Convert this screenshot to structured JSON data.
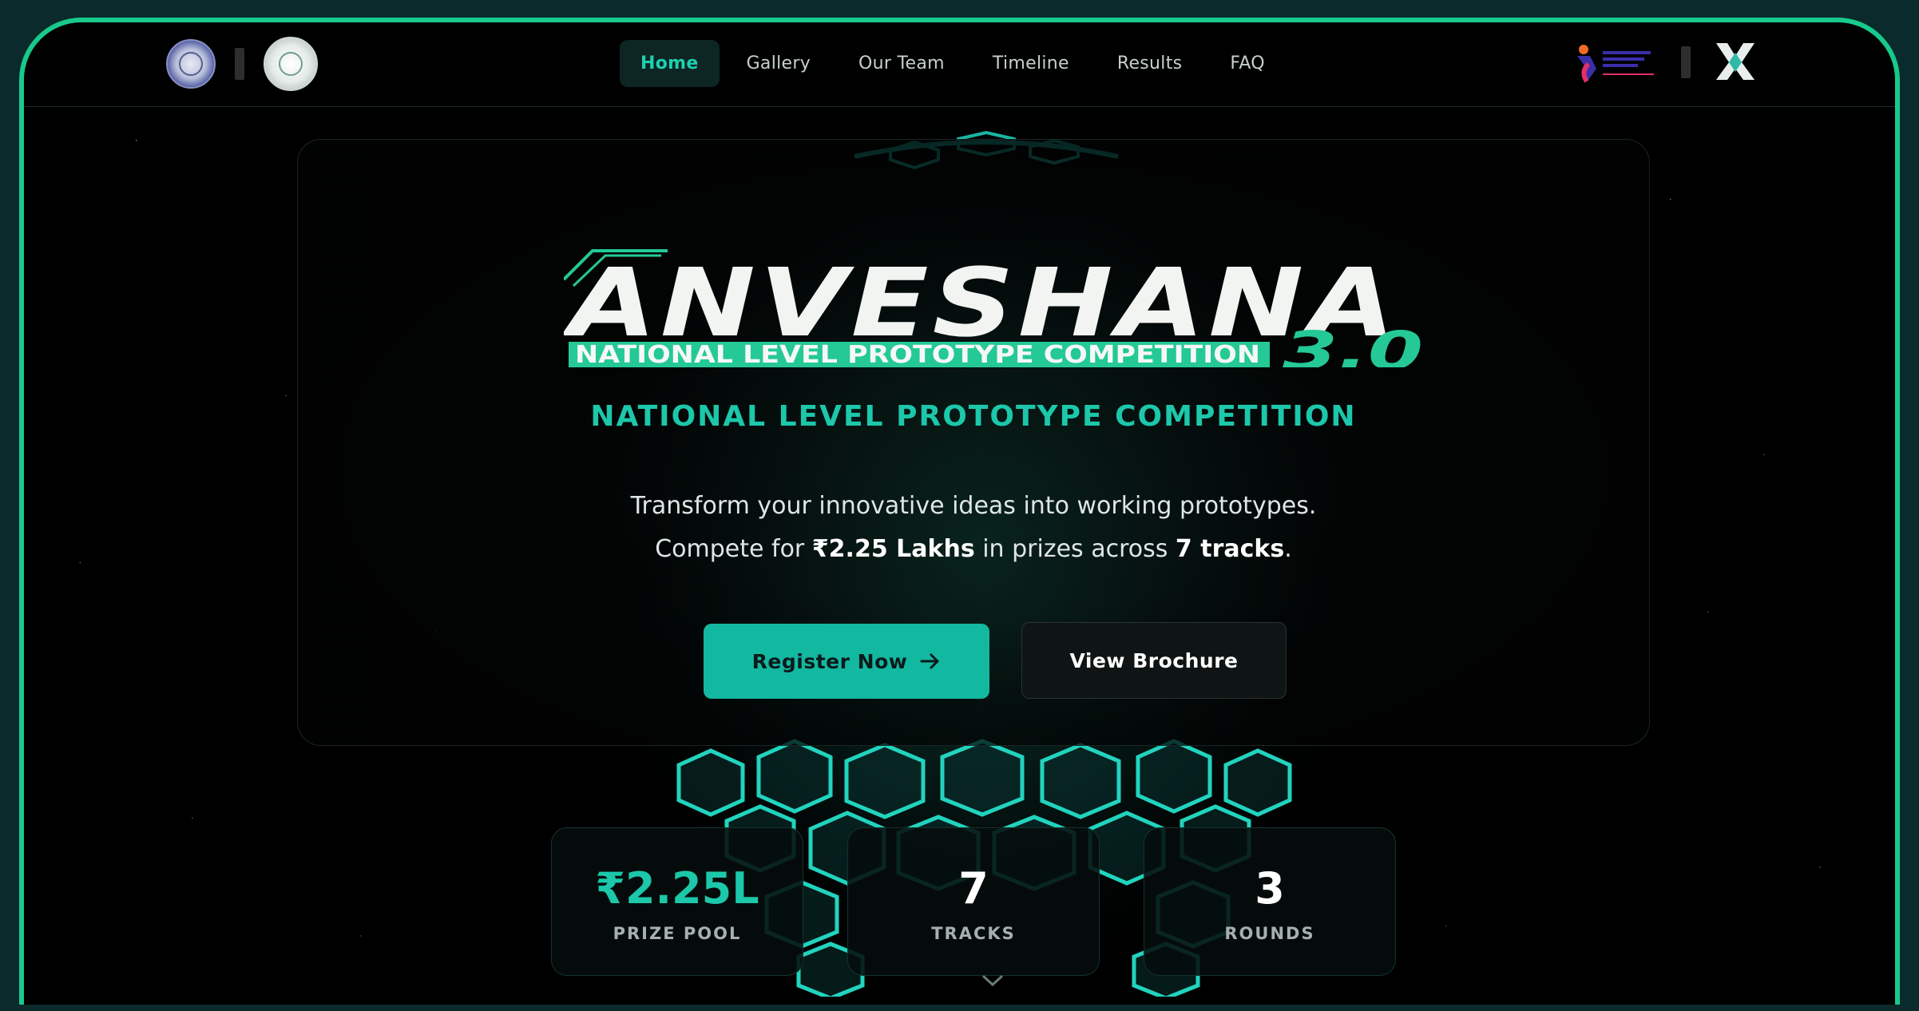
{
  "colors": {
    "accent": "#1cc7aa",
    "frame": "#18c98c",
    "background": "#000000",
    "button_primary": "#13b8a1"
  },
  "nav": {
    "left_logos": [
      "institute-seal-icon",
      "department-seal-icon"
    ],
    "right_logos": [
      "innovation-council-logo",
      "anveshana-logo"
    ],
    "items": [
      {
        "label": "Home",
        "active": true
      },
      {
        "label": "Gallery",
        "active": false
      },
      {
        "label": "Our Team",
        "active": false
      },
      {
        "label": "Timeline",
        "active": false
      },
      {
        "label": "Results",
        "active": false
      },
      {
        "label": "FAQ",
        "active": false
      }
    ]
  },
  "hero": {
    "logo_title": "ANVESHANA",
    "logo_subtitle": "NATIONAL LEVEL PROTOTYPE  COMPETITION",
    "logo_version": "3.0",
    "tagline": "NATIONAL LEVEL PROTOTYPE COMPETITION",
    "description_line1": "Transform your innovative ideas into working prototypes.",
    "description_line2_prefix": "Compete for ",
    "description_prize": "₹2.25 Lakhs",
    "description_line2_middle": " in prizes across ",
    "description_tracks": "7 tracks",
    "description_line2_suffix": ".",
    "register_label": "Register Now",
    "brochure_label": "View Brochure"
  },
  "stats": [
    {
      "value": "₹2.25L",
      "label": "PRIZE POOL"
    },
    {
      "value": "7",
      "label": "TRACKS"
    },
    {
      "value": "3",
      "label": "ROUNDS"
    }
  ]
}
